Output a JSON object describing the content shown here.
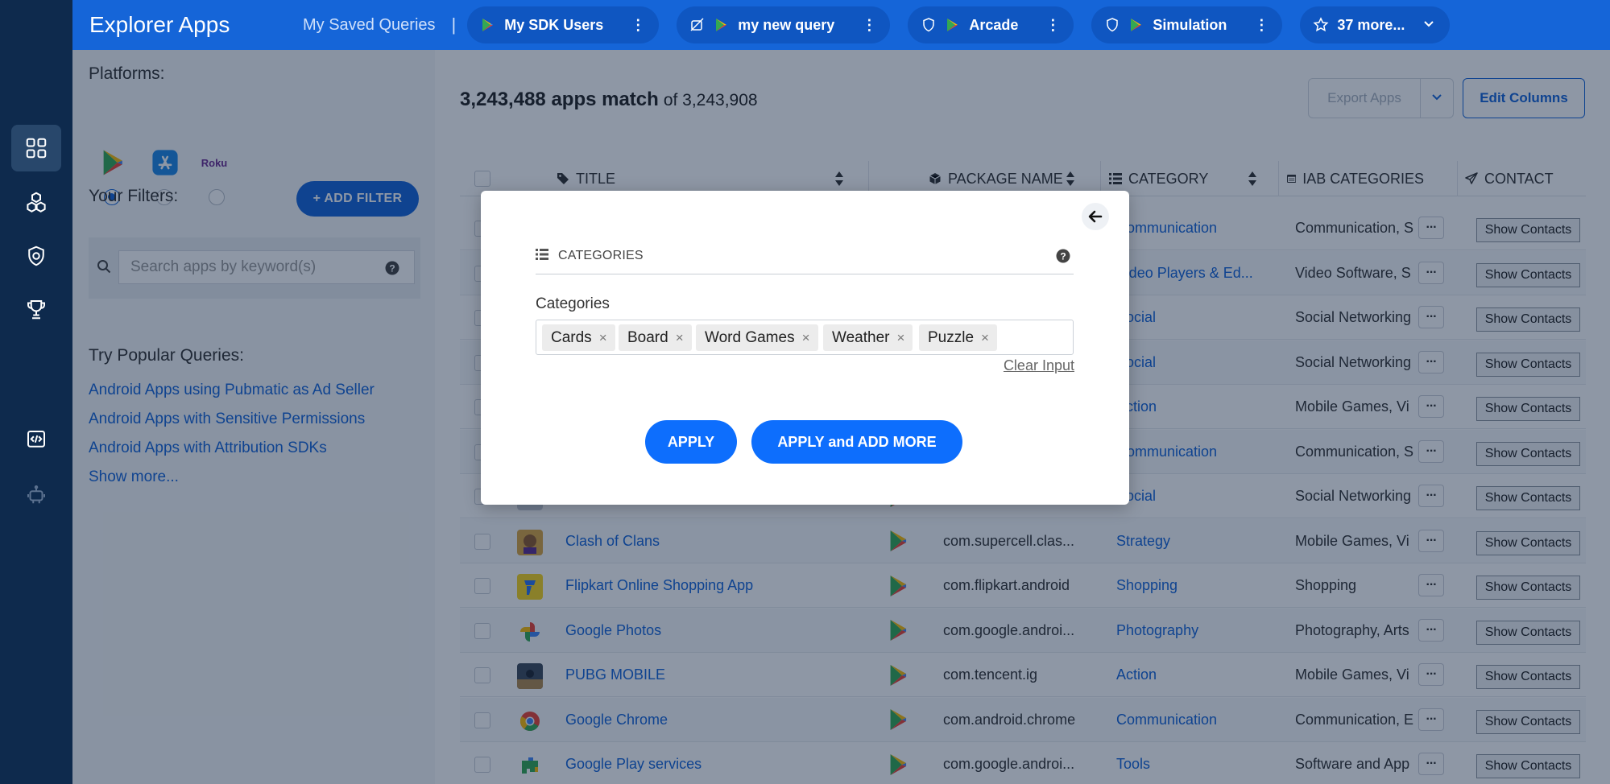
{
  "header": {
    "app_title": "Explorer Apps",
    "saved_label": "My Saved Queries",
    "separator": "|",
    "tabs": [
      {
        "label": "My SDK Users",
        "icon": "google-play-icon"
      },
      {
        "label": "my new query",
        "icon": "google-play-icon",
        "status_icon": "hidden-icon"
      },
      {
        "label": "Arcade",
        "icon": "google-play-icon",
        "status_icon": "shield-icon"
      },
      {
        "label": "Simulation",
        "icon": "google-play-icon",
        "status_icon": "shield-icon"
      }
    ],
    "more_label": "37 more...",
    "more_icon": "star-icon"
  },
  "sidebar": {
    "icons": [
      "dashboard-icon",
      "cubes-icon",
      "shield-icon",
      "trophy-icon",
      "code-icon",
      "robot-icon"
    ]
  },
  "filters": {
    "platforms_label": "Platforms:",
    "platforms": [
      {
        "name": "google-play-icon",
        "selected": true
      },
      {
        "name": "app-store-icon",
        "selected": false
      },
      {
        "name": "Roku",
        "selected": false
      }
    ],
    "your_filters_label": "Your Filters:",
    "add_filter_label": "+ ADD FILTER",
    "search_placeholder": "Search apps by keyword(s)",
    "popular_label": "Try Popular Queries:",
    "popular_queries": [
      "Android Apps using Pubmatic as Ad Seller",
      "Android Apps with Sensitive Permissions",
      "Android Apps with Attribution SDKs",
      "Show more..."
    ]
  },
  "results": {
    "match_count": "3,243,488 apps match",
    "of_total": "of 3,243,908",
    "export_label": "Export Apps",
    "edit_columns_label": "Edit Columns",
    "columns": [
      "TITLE",
      "PACKAGE NAME",
      "CATEGORY",
      "IAB CATEGORIES",
      "CONTACT"
    ],
    "contact_label": "Show Contacts",
    "more_glyph": "···",
    "rows": [
      {
        "title": "",
        "package": "",
        "category": "Communication",
        "iab": "Communication, S"
      },
      {
        "title": "",
        "package": "",
        "category": "Video Players & Ed...",
        "iab": "Video Software, S"
      },
      {
        "title": "",
        "package": "",
        "category": "Social",
        "iab": "Social Networking"
      },
      {
        "title": "",
        "package": "",
        "category": "Social",
        "iab": "Social Networking"
      },
      {
        "title": "",
        "package": "",
        "category": "Action",
        "iab": "Mobile Games, Vi"
      },
      {
        "title": "",
        "package": "",
        "category": "Communication",
        "iab": "Communication, S"
      },
      {
        "title": "",
        "package": "",
        "category": "Social",
        "iab": "Social Networking"
      },
      {
        "title": "Clash of Clans",
        "package": "com.supercell.clas...",
        "category": "Strategy",
        "iab": "Mobile Games, Vi"
      },
      {
        "title": "Flipkart Online Shopping App",
        "package": "com.flipkart.android",
        "category": "Shopping",
        "iab": "Shopping"
      },
      {
        "title": "Google Photos",
        "package": "com.google.androi...",
        "category": "Photography",
        "iab": "Photography, Arts"
      },
      {
        "title": "PUBG MOBILE",
        "package": "com.tencent.ig",
        "category": "Action",
        "iab": "Mobile Games, Vi"
      },
      {
        "title": "Google Chrome",
        "package": "com.android.chrome",
        "category": "Communication",
        "iab": "Communication, E"
      },
      {
        "title": "Google Play services",
        "package": "com.google.androi...",
        "category": "Tools",
        "iab": "Software and App"
      }
    ]
  },
  "modal": {
    "header_label": "CATEGORIES",
    "field_label": "Categories",
    "tags": [
      "Cards",
      "Board",
      "Word Games",
      "Weather",
      "Puzzle"
    ],
    "tag_remove_glyph": "×",
    "clear_label": "Clear Input",
    "apply_label": "APPLY",
    "apply_more_label": "APPLY and ADD MORE"
  },
  "colors": {
    "topbar": "#1565d8",
    "tab": "#0f56c1",
    "rail": "#0e2a4d",
    "primary": "#0d6efd",
    "link": "#1565d8"
  }
}
